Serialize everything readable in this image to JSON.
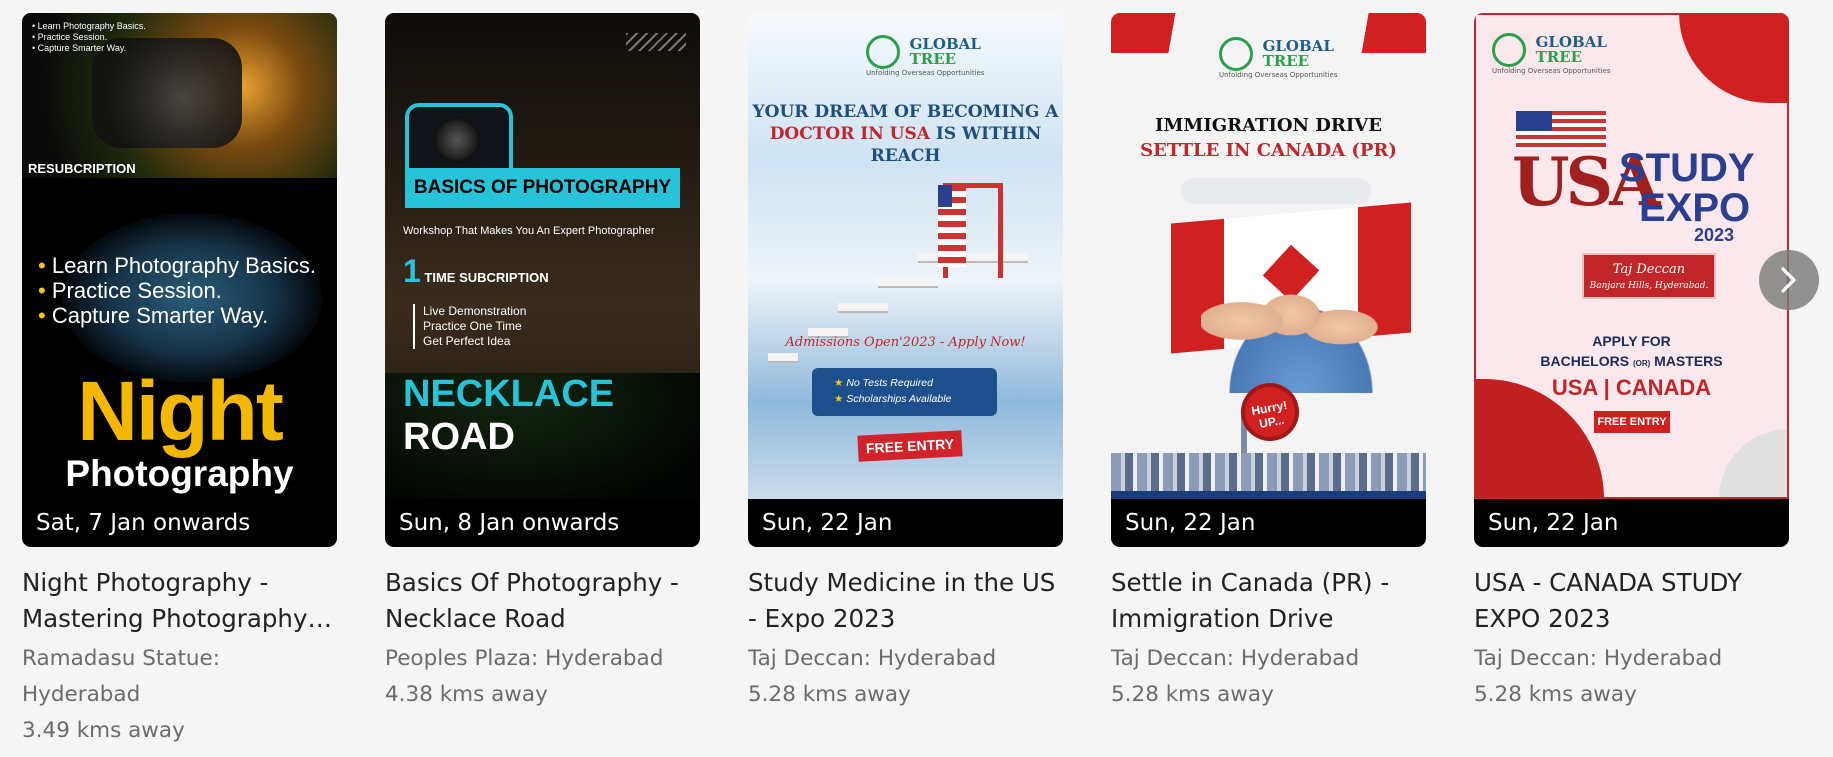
{
  "events": [
    {
      "date": "Sat, 7 Jan onwards",
      "title": "Night Photography - Mastering Photography…",
      "venue": "Ramadasu Statue: Hyderabad",
      "distance": "3.49 kms away",
      "poster": {
        "mini_lines": "• Learn Photography Basics.\n• Practice Session.\n• Capture Smarter Way.",
        "subtitle": "RESUBCRIPTION",
        "bullets": [
          "Learn Photography Basics.",
          "Practice Session.",
          "Capture Smarter Way."
        ],
        "headline": "Night",
        "subheadline": "Photography"
      }
    },
    {
      "date": "Sun, 8 Jan onwards",
      "title": "Basics Of Photography - Necklace Road",
      "venue": "Peoples Plaza: Hyderabad",
      "distance": "4.38 kms away",
      "poster": {
        "banner": "BASICS OF PHOTOGRAPHY",
        "tagline": "Workshop That Makes You An Expert Photographer",
        "one_num": "1",
        "one_text": "TIME SUBCRIPTION",
        "list": [
          "Live Demonstration",
          "Practice One Time",
          "Get Perfect Idea"
        ],
        "road_a": "NECKLACE",
        "road_b": "ROAD"
      }
    },
    {
      "date": "Sun, 22 Jan",
      "title": "Study Medicine in the US - Expo 2023",
      "venue": "Taj Deccan: Hyderabad",
      "distance": "5.28 kms away",
      "poster": {
        "brand": "GLOBAL",
        "brand2": "TREE",
        "brand_tag": "Unfolding Overseas Opportunities",
        "line1": "YOUR DREAM OF BECOMING A",
        "line2a": "DOCTOR IN USA",
        "line2b": "IS WITHIN REACH",
        "admissions": "Admissions Open'2023 - Apply Now!",
        "perk1": "No Tests Required",
        "perk2": "Scholarships Available",
        "free": "FREE ENTRY"
      }
    },
    {
      "date": "Sun, 22 Jan",
      "title": "Settle in Canada (PR) - Immigration Drive",
      "venue": "Taj Deccan: Hyderabad",
      "distance": "5.28 kms away",
      "poster": {
        "brand": "GLOBAL",
        "brand2": "TREE",
        "brand_tag": "Unfolding Overseas Opportunities",
        "line1": "IMMIGRATION DRIVE",
        "line2": "SETTLE IN CANADA (PR)",
        "hurry": "Hurry! UP..."
      }
    },
    {
      "date": "Sun, 22 Jan",
      "title": "USA - CANADA STUDY EXPO 2023",
      "venue": "Taj Deccan: Hyderabad",
      "distance": "5.28 kms away",
      "poster": {
        "brand": "GLOBAL",
        "brand2": "TREE",
        "brand_tag": "Unfolding Overseas Opportunities",
        "usa": "USA",
        "study": "STUDY",
        "expo": "EXPO",
        "year": "2023",
        "venue_name": "Taj Deccan",
        "venue_sub": "Banjara Hills, Hyderabad.",
        "apply1": "APPLY FOR",
        "apply2": "BACHELORS",
        "apply_or": "(OR)",
        "apply3": "MASTERS",
        "countries": "USA | CANADA",
        "free": "FREE ENTRY"
      }
    }
  ],
  "next_button": {
    "icon": "chevron-right-icon"
  },
  "colors": {
    "page_bg": "#f5f5f5",
    "date_bar": "#000000",
    "title_text": "#222222",
    "meta_text": "#6b6b6b"
  }
}
